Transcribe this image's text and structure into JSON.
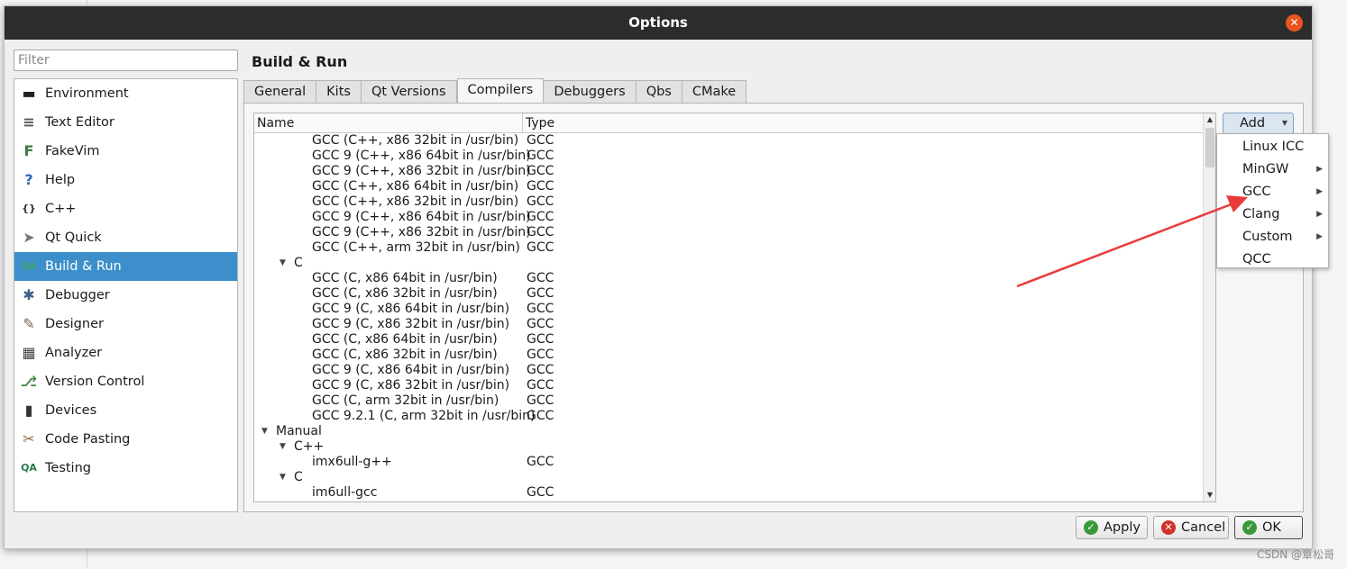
{
  "window": {
    "title": "Options"
  },
  "filter": {
    "placeholder": "Filter"
  },
  "sidebar": {
    "items": [
      {
        "label": "Environment",
        "icon": "monitor-icon"
      },
      {
        "label": "Text Editor",
        "icon": "text-editor-icon"
      },
      {
        "label": "FakeVim",
        "icon": "fakevim-icon"
      },
      {
        "label": "Help",
        "icon": "help-icon"
      },
      {
        "label": "C++",
        "icon": "braces-icon"
      },
      {
        "label": "Qt Quick",
        "icon": "paper-plane-icon"
      },
      {
        "label": "Build & Run",
        "icon": "qt-build-icon"
      },
      {
        "label": "Debugger",
        "icon": "bug-icon"
      },
      {
        "label": "Designer",
        "icon": "designer-tools-icon"
      },
      {
        "label": "Analyzer",
        "icon": "analyzer-icon"
      },
      {
        "label": "Version Control",
        "icon": "version-control-icon"
      },
      {
        "label": "Devices",
        "icon": "device-icon"
      },
      {
        "label": "Code Pasting",
        "icon": "code-pasting-icon"
      },
      {
        "label": "Testing",
        "icon": "qa-icon"
      }
    ],
    "selected": "Build & Run"
  },
  "page_title": "Build & Run",
  "tabs": [
    "General",
    "Kits",
    "Qt Versions",
    "Compilers",
    "Debuggers",
    "Qbs",
    "CMake"
  ],
  "active_tab": "Compilers",
  "tree": {
    "columns": [
      "Name",
      "Type"
    ],
    "rows": [
      {
        "indent": 3,
        "name": "GCC (C++, x86 32bit in /usr/bin)",
        "type": "GCC"
      },
      {
        "indent": 3,
        "name": "GCC 9 (C++, x86 64bit in /usr/bin)",
        "type": "GCC"
      },
      {
        "indent": 3,
        "name": "GCC 9 (C++, x86 32bit in /usr/bin)",
        "type": "GCC"
      },
      {
        "indent": 3,
        "name": "GCC (C++, x86 64bit in /usr/bin)",
        "type": "GCC"
      },
      {
        "indent": 3,
        "name": "GCC (C++, x86 32bit in /usr/bin)",
        "type": "GCC"
      },
      {
        "indent": 3,
        "name": "GCC 9 (C++, x86 64bit in /usr/bin)",
        "type": "GCC"
      },
      {
        "indent": 3,
        "name": "GCC 9 (C++, x86 32bit in /usr/bin)",
        "type": "GCC"
      },
      {
        "indent": 3,
        "name": "GCC (C++, arm 32bit in /usr/bin)",
        "type": "GCC"
      },
      {
        "indent": 2,
        "name": "C",
        "type": "",
        "expanded": true
      },
      {
        "indent": 3,
        "name": "GCC (C, x86 64bit in /usr/bin)",
        "type": "GCC"
      },
      {
        "indent": 3,
        "name": "GCC (C, x86 32bit in /usr/bin)",
        "type": "GCC"
      },
      {
        "indent": 3,
        "name": "GCC 9 (C, x86 64bit in /usr/bin)",
        "type": "GCC"
      },
      {
        "indent": 3,
        "name": "GCC 9 (C, x86 32bit in /usr/bin)",
        "type": "GCC"
      },
      {
        "indent": 3,
        "name": "GCC (C, x86 64bit in /usr/bin)",
        "type": "GCC"
      },
      {
        "indent": 3,
        "name": "GCC (C, x86 32bit in /usr/bin)",
        "type": "GCC"
      },
      {
        "indent": 3,
        "name": "GCC 9 (C, x86 64bit in /usr/bin)",
        "type": "GCC"
      },
      {
        "indent": 3,
        "name": "GCC 9 (C, x86 32bit in /usr/bin)",
        "type": "GCC"
      },
      {
        "indent": 3,
        "name": "GCC (C, arm 32bit in /usr/bin)",
        "type": "GCC"
      },
      {
        "indent": 3,
        "name": "GCC 9.2.1 (C, arm 32bit in /usr/bin)",
        "type": "GCC"
      },
      {
        "indent": 1,
        "name": "Manual",
        "type": "",
        "expanded": true
      },
      {
        "indent": 2,
        "name": "C++",
        "type": "",
        "expanded": true
      },
      {
        "indent": 3,
        "name": "imx6ull-g++",
        "type": "GCC"
      },
      {
        "indent": 2,
        "name": "C",
        "type": "",
        "expanded": true
      },
      {
        "indent": 3,
        "name": "im6ull-gcc",
        "type": "GCC"
      }
    ]
  },
  "add_button": {
    "label": "Add"
  },
  "add_menu": [
    {
      "label": "Linux ICC",
      "submenu": false
    },
    {
      "label": "MinGW",
      "submenu": true
    },
    {
      "label": "GCC",
      "submenu": true
    },
    {
      "label": "Clang",
      "submenu": true
    },
    {
      "label": "Custom",
      "submenu": true
    },
    {
      "label": "QCC",
      "submenu": false
    }
  ],
  "buttons": {
    "apply": "Apply",
    "cancel": "Cancel",
    "ok": "OK"
  },
  "colors": {
    "selection": "#3c8fca",
    "titlebar": "#2c2c2c",
    "close": "#e95420",
    "annotation_arrow": "#e83a3a"
  },
  "watermark": "CSDN @章松哥"
}
